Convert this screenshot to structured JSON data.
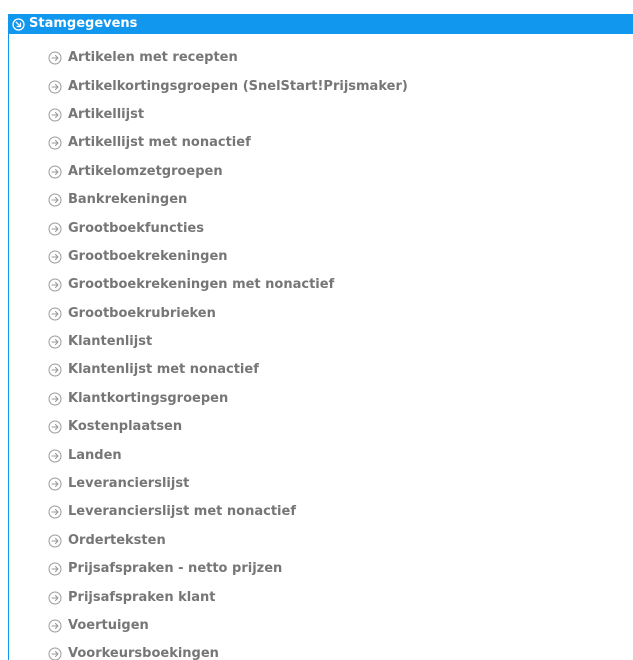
{
  "section": {
    "title": "Stamgegevens",
    "icon": "circle-arrow-down-right-icon",
    "color": "#1297ef",
    "items": [
      "Artikelen met recepten",
      "Artikelkortingsgroepen (SnelStart!Prijsmaker)",
      "Artikellijst",
      "Artikellijst met nonactief",
      "Artikelomzetgroepen",
      "Bankrekeningen",
      "Grootboekfuncties",
      "Grootboekrekeningen",
      "Grootboekrekeningen met nonactief",
      "Grootboekrubrieken",
      "Klantenlijst",
      "Klantenlijst met nonactief",
      "Klantkortingsgroepen",
      "Kostenplaatsen",
      "Landen",
      "Leverancierslijst",
      "Leverancierslijst met nonactief",
      "Orderteksten",
      "Prijsafspraken - netto prijzen",
      "Prijsafspraken klant",
      "Voertuigen",
      "Voorkeursboekingen"
    ],
    "item_icon": "circle-arrow-right-icon"
  }
}
